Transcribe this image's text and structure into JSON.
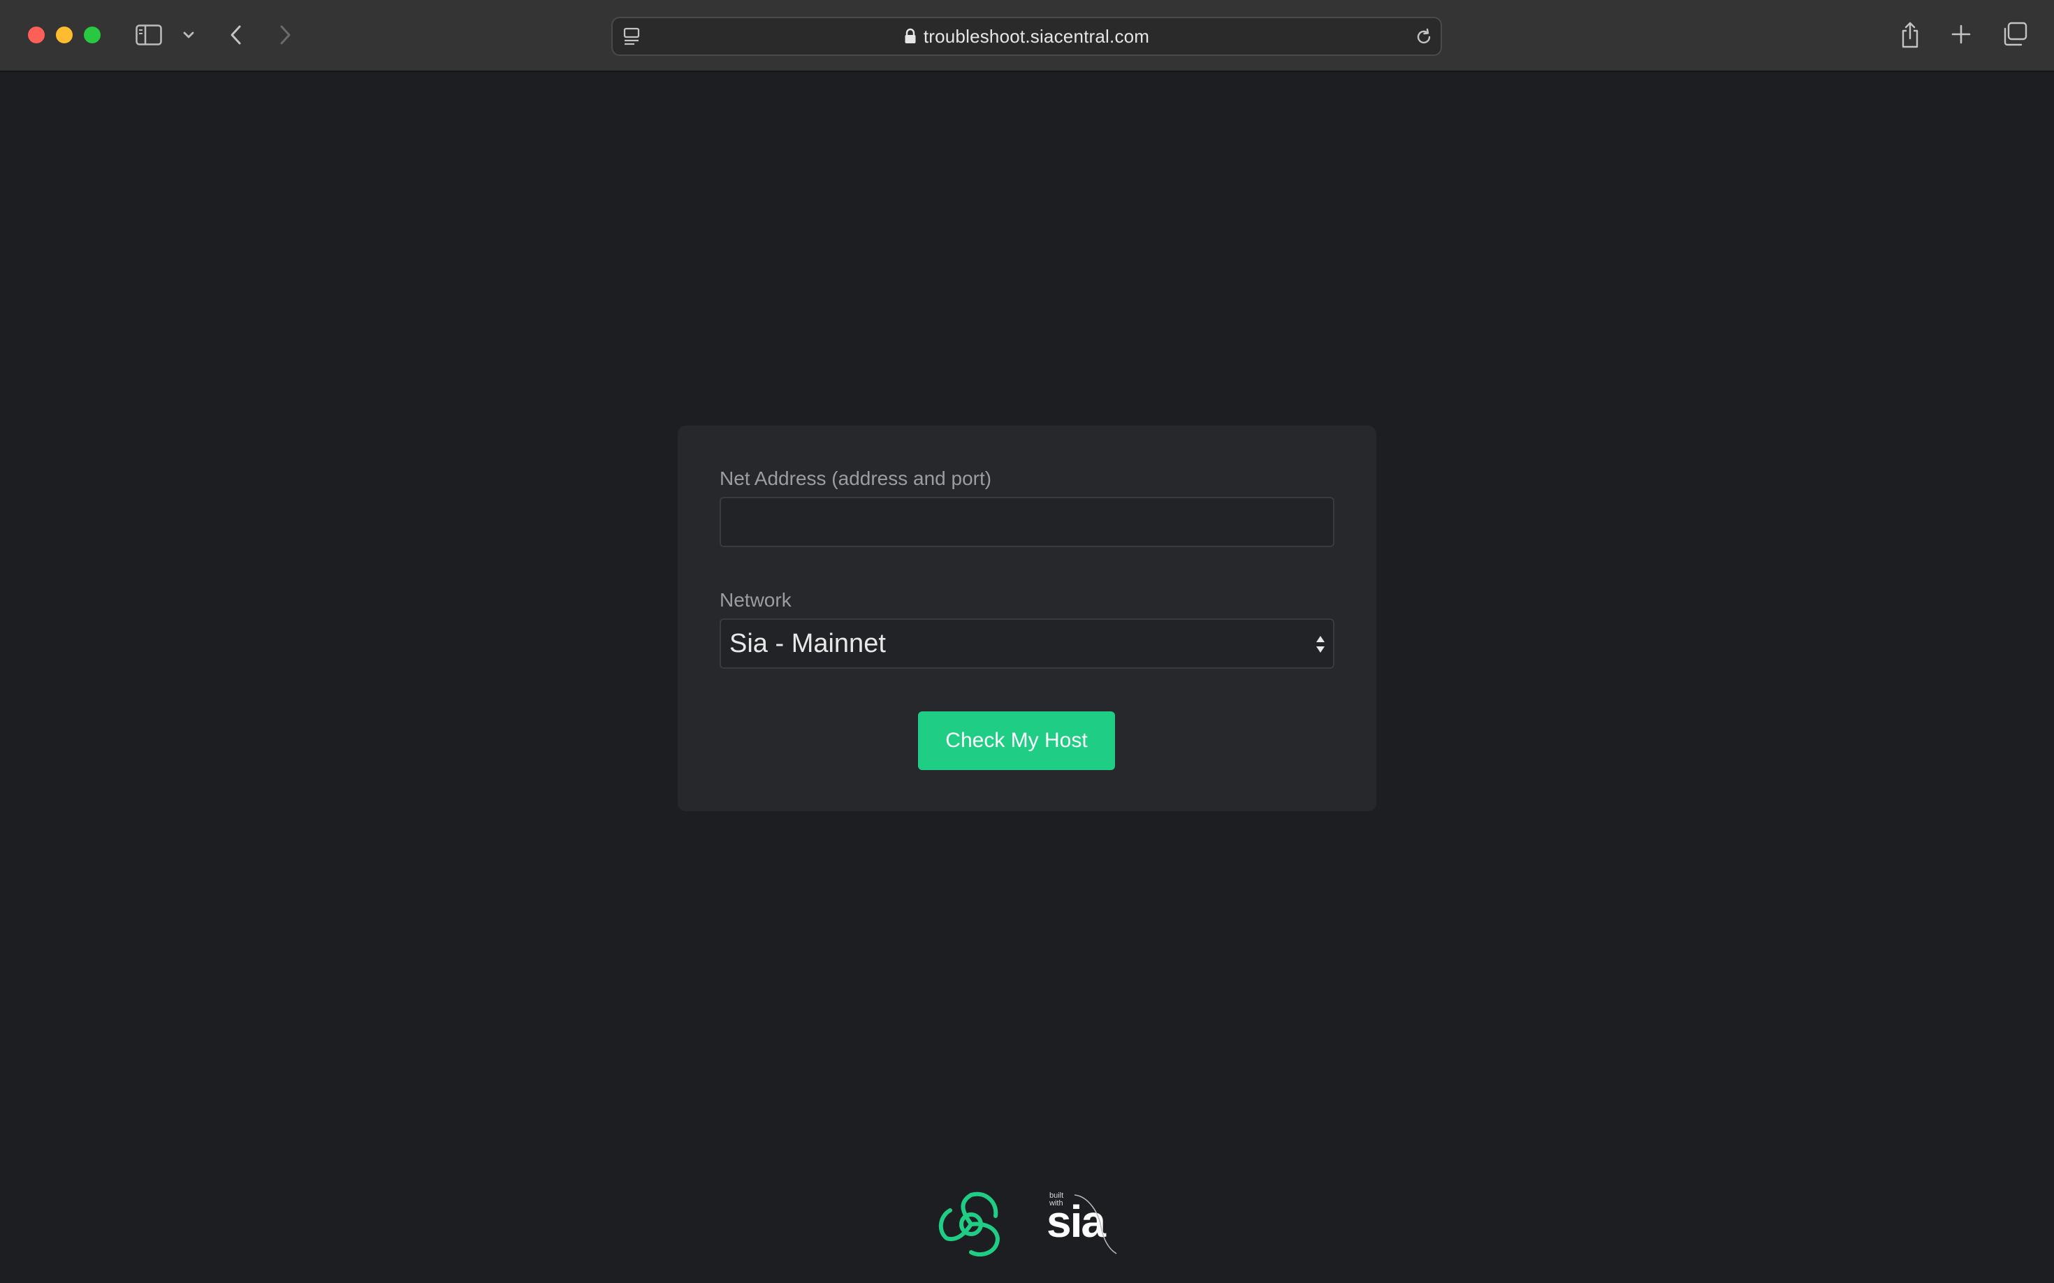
{
  "browser": {
    "url": "troubleshoot.siacentral.com",
    "icons": {
      "close": "close-dot",
      "minimize": "minimize-dot",
      "maximize": "maximize-dot",
      "sidebar": "sidebar-icon",
      "chevron": "chevron-down-icon",
      "back": "back-arrow-icon",
      "forward": "forward-arrow-icon",
      "reader": "reader-icon",
      "lock": "lock-icon",
      "reload": "reload-icon",
      "share": "share-icon",
      "new_tab": "plus-icon",
      "tabs": "tab-overview-icon"
    },
    "colors": {
      "close": "#fe5f57",
      "minimize": "#febc2e",
      "maximize": "#28c840"
    }
  },
  "form": {
    "net_address_label": "Net Address (address and port)",
    "net_address_value": "",
    "network_label": "Network",
    "network_selected": "Sia - Mainnet",
    "submit_label": "Check My Host"
  },
  "footer": {
    "built_with_line1": "built",
    "built_with_line2": "with",
    "brand_word": "sia",
    "logo_icon": "sia-central-logo-icon"
  },
  "colors": {
    "accent": "#1fce84",
    "background": "#1d1e21",
    "card": "#27282c"
  }
}
